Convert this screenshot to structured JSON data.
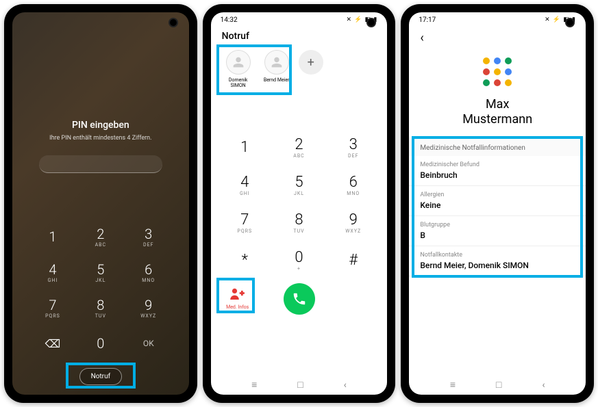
{
  "phone1": {
    "pin_title": "PIN eingeben",
    "pin_subtitle": "Ihre PIN enthält mindestens 4 Ziffern.",
    "keys": [
      {
        "num": "1",
        "sub": ""
      },
      {
        "num": "2",
        "sub": "ABC"
      },
      {
        "num": "3",
        "sub": "DEF"
      },
      {
        "num": "4",
        "sub": "GHI"
      },
      {
        "num": "5",
        "sub": "JKL"
      },
      {
        "num": "6",
        "sub": "MNO"
      },
      {
        "num": "7",
        "sub": "PQRS"
      },
      {
        "num": "8",
        "sub": "TUV"
      },
      {
        "num": "9",
        "sub": "WXYZ"
      }
    ],
    "zero": "0",
    "ok": "OK",
    "notruf": "Notruf"
  },
  "phone2": {
    "time": "14:32",
    "title": "Notruf",
    "contacts": [
      {
        "name": "Domenik SIMON"
      },
      {
        "name": "Bernd Meier"
      }
    ],
    "keys": [
      {
        "num": "1",
        "sub": ""
      },
      {
        "num": "2",
        "sub": "ABC"
      },
      {
        "num": "3",
        "sub": "DEF"
      },
      {
        "num": "4",
        "sub": "GHI"
      },
      {
        "num": "5",
        "sub": "JKL"
      },
      {
        "num": "6",
        "sub": "MNO"
      },
      {
        "num": "7",
        "sub": "PQRS"
      },
      {
        "num": "8",
        "sub": "TUV"
      },
      {
        "num": "9",
        "sub": "WXYZ"
      },
      {
        "num": "*",
        "sub": ""
      },
      {
        "num": "0",
        "sub": "+"
      },
      {
        "num": "#",
        "sub": ""
      }
    ],
    "med_label": "Med. Infos"
  },
  "phone3": {
    "time": "17:17",
    "name_first": "Max",
    "name_last": "Mustermann",
    "section_header": "Medizinische Notfallinformationen",
    "fields": [
      {
        "label": "Medizinischer Befund",
        "value": "Beinbruch"
      },
      {
        "label": "Allergien",
        "value": "Keine"
      },
      {
        "label": "Blutgruppe",
        "value": "B"
      },
      {
        "label": "Notfallkontakte",
        "value": "Bernd Meier, Domenik SIMON"
      }
    ]
  }
}
